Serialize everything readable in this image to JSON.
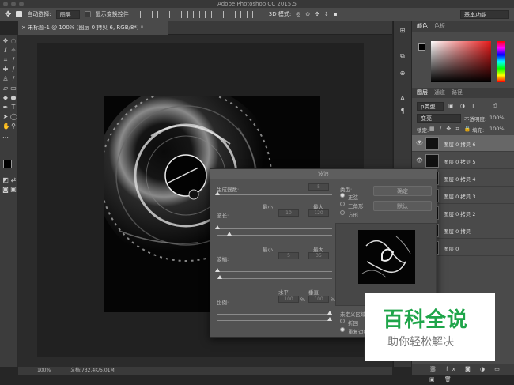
{
  "app": {
    "title": "Adobe Photoshop CC 2015.5"
  },
  "options_bar": {
    "auto_select_label": "自动选择:",
    "auto_select_value": "图层",
    "show_transform_label": "显示变换控件",
    "mode_3d_label": "3D 模式:",
    "workspace": "基本功能"
  },
  "document": {
    "tab_title": "未标题-1 @ 100% (图层 0 拷贝 6, RGB/8*) *",
    "close_glyph": "×",
    "zoom": "100%",
    "doc_info": "文档:732.4K/5.01M"
  },
  "color_panel": {
    "tabs": [
      "颜色",
      "色板"
    ]
  },
  "layers_panel": {
    "tabs": [
      "图层",
      "通道",
      "路径"
    ],
    "filter_label": "ρ类型",
    "blend_mode": "变亮",
    "opacity_label": "不透明度:",
    "opacity_value": "100%",
    "lock_label": "锁定:",
    "fill_label": "填充:",
    "fill_value": "100%",
    "visibility_glyph": "👁",
    "layers": [
      {
        "name": "图层 0 拷贝 6",
        "visible": true,
        "selected": true
      },
      {
        "name": "图层 0 拷贝 5",
        "visible": true,
        "selected": false
      },
      {
        "name": "图层 0 拷贝 4",
        "visible": false,
        "selected": false
      },
      {
        "name": "图层 0 拷贝 3",
        "visible": false,
        "selected": false
      },
      {
        "name": "图层 0 拷贝 2",
        "visible": false,
        "selected": false
      },
      {
        "name": "图层 0 拷贝",
        "visible": false,
        "selected": false
      },
      {
        "name": "图层 0",
        "visible": false,
        "selected": false
      }
    ]
  },
  "wave_dialog": {
    "title": "波浪",
    "generators_label": "生成器数:",
    "generators_value": "5",
    "wavelength_label": "波长:",
    "amplitude_label": "波幅:",
    "scale_label": "比例:",
    "min_label": "最小",
    "max_label": "最大",
    "horizontal_label": "水平",
    "vertical_label": "垂直",
    "wavelength_min": "10",
    "wavelength_max": "120",
    "amplitude_min": "5",
    "amplitude_max": "35",
    "scale_h": "100",
    "scale_v": "100",
    "percent": "%",
    "type_label": "类型:",
    "type_options": [
      "正弦",
      "三角形",
      "方形"
    ],
    "ok_button": "确定",
    "default_button": "默认",
    "undefined_label": "未定义区域:",
    "undefined_options": [
      "折回",
      "重复边缘像素"
    ]
  },
  "watermark": {
    "title": "百科全说",
    "subtitle": "助你轻松解决",
    "title_color": "#1fa54a"
  }
}
